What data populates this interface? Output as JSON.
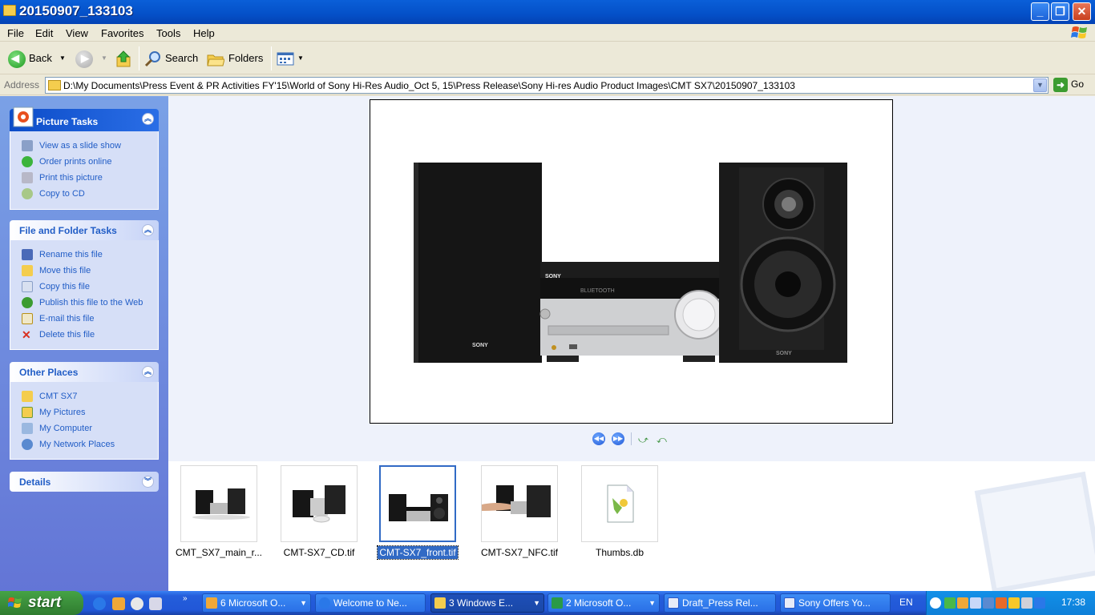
{
  "window": {
    "title": "20150907_133103"
  },
  "menu": [
    "File",
    "Edit",
    "View",
    "Favorites",
    "Tools",
    "Help"
  ],
  "toolbar": {
    "back_label": "Back",
    "search_label": "Search",
    "folders_label": "Folders"
  },
  "address": {
    "label": "Address",
    "path": "D:\\My Documents\\Press Event & PR Activities FY'15\\World of Sony Hi-Res Audio_Oct 5, 15\\Press Release\\Sony Hi-res Audio Product Images\\CMT SX7\\20150907_133103",
    "go_label": "Go"
  },
  "taskpane": {
    "picture_tasks": {
      "title": "Picture Tasks",
      "items": [
        "View as a slide show",
        "Order prints online",
        "Print this picture",
        "Copy to CD"
      ]
    },
    "file_folder_tasks": {
      "title": "File and Folder Tasks",
      "items": [
        "Rename this file",
        "Move this file",
        "Copy this file",
        "Publish this file to the Web",
        "E-mail this file",
        "Delete this file"
      ]
    },
    "other_places": {
      "title": "Other Places",
      "items": [
        "CMT SX7",
        "My Pictures",
        "My Computer",
        "My Network Places"
      ]
    },
    "details": {
      "title": "Details"
    }
  },
  "preview": {
    "brand_left": "SONY",
    "brand_center": "SONY",
    "brand_right": "SONY",
    "bluetooth_text": "BLUETOOTH"
  },
  "files": [
    {
      "name": "CMT_SX7_main_r...",
      "selected": false
    },
    {
      "name": "CMT-SX7_CD.tif",
      "selected": false
    },
    {
      "name": "CMT-SX7_front.tif",
      "selected": true
    },
    {
      "name": "CMT-SX7_NFC.tif",
      "selected": false
    },
    {
      "name": "Thumbs.db",
      "selected": false
    }
  ],
  "taskbar": {
    "start_label": "start",
    "tasks": [
      {
        "label": "6 Microsoft O...",
        "active": false
      },
      {
        "label": "Welcome to Ne...",
        "active": false
      },
      {
        "label": "3 Windows E...",
        "active": true
      },
      {
        "label": "2 Microsoft O...",
        "active": false
      },
      {
        "label": "Draft_Press Rel...",
        "active": false
      },
      {
        "label": "Sony Offers Yo...",
        "active": false
      }
    ],
    "language": "EN",
    "clock": "17:38"
  }
}
